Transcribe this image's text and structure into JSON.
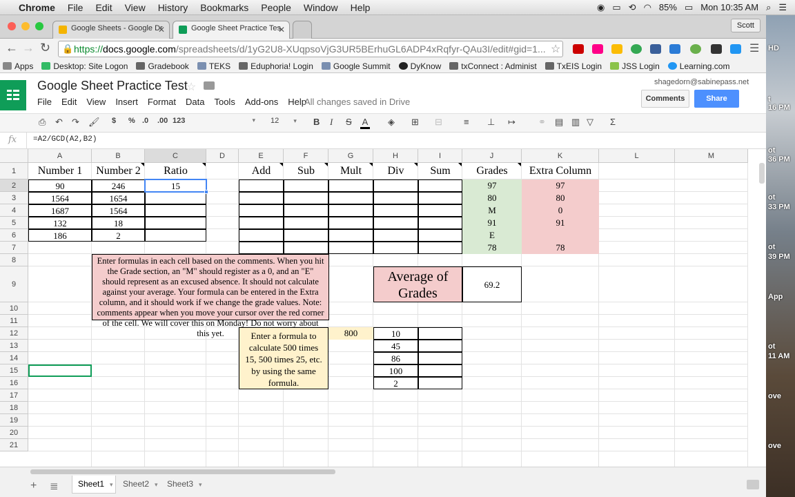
{
  "menubar": {
    "app": "Chrome",
    "items": [
      "File",
      "Edit",
      "View",
      "History",
      "Bookmarks",
      "People",
      "Window",
      "Help"
    ],
    "battery": "85%",
    "clock": "Mon 10:35 AM"
  },
  "browser": {
    "tabs": [
      {
        "title": "Google Sheets - Google Dr"
      },
      {
        "title": "Google Sheet Practice Tes"
      }
    ],
    "profile": "Scott",
    "url_scheme": "https://",
    "url_domain": "docs.google.com",
    "url_rest": "/spreadsheets/d/1yG2U8-XUqpsoVjG3UR5BErhuGL6ADP4xRqfyr-QAu3I/edit#gid=1...",
    "bookmarks": [
      "Apps",
      "Desktop: Site Logon",
      "Gradebook",
      "TEKS",
      "Eduphoria! Login",
      "Google Summit",
      "DyKnow",
      "txConnect : Administ",
      "TxEIS Login",
      "JSS Login",
      "Learning.com"
    ]
  },
  "doc": {
    "title": "Google Sheet Practice Test",
    "menus": [
      "File",
      "Edit",
      "View",
      "Insert",
      "Format",
      "Data",
      "Tools",
      "Add-ons",
      "Help"
    ],
    "saved_status": "All changes saved in Drive",
    "account": "shagedorn@sabinepass.net",
    "comments_label": "Comments",
    "share_label": "Share"
  },
  "format_toolbar": {
    "currency": "$",
    "percent": "%",
    "dec_less": ".0",
    "dec_more": ".00",
    "number_format": "123",
    "font_size": "12",
    "bold": "B",
    "italic": "I",
    "strike": "S",
    "text_color": "A",
    "functions": "Σ"
  },
  "formula_bar": {
    "fx": "fx",
    "formula": "=A2/GCD(A2,B2)"
  },
  "columns": [
    "A",
    "B",
    "C",
    "D",
    "E",
    "F",
    "G",
    "H",
    "I",
    "J",
    "K",
    "L",
    "M"
  ],
  "rows": [
    "1",
    "2",
    "3",
    "4",
    "5",
    "6",
    "7",
    "8",
    "9",
    "10",
    "11",
    "12",
    "13",
    "14",
    "15",
    "16",
    "17",
    "18",
    "19",
    "20",
    "21"
  ],
  "cells": {
    "A1": "Number 1",
    "B1": "Number 2",
    "C1": "Ratio",
    "E1": "Add",
    "F1": "Sub",
    "G1": "Mult",
    "H1": "Div",
    "I1": "Sum",
    "J1": "Grades",
    "K1": "Extra Column",
    "A2": "90",
    "B2": "246",
    "C2": "15",
    "A3": "1564",
    "B3": "1654",
    "A4": "1687",
    "B4": "1564",
    "A5": "132",
    "B5": "18",
    "A6": "186",
    "B6": "2",
    "J2": "97",
    "J3": "80",
    "J4": "M",
    "J5": "91",
    "J6": "E",
    "J7": "78",
    "K2": "97",
    "K3": "80",
    "K4": "0",
    "K5": "91",
    "K6": "",
    "K7": "78",
    "H9": "Average of Grades",
    "J9": "69.2",
    "G12": "800",
    "H12": "10",
    "H13": "45",
    "H14": "86",
    "H15": "100",
    "H16": "2"
  },
  "notes": {
    "instructions": "Enter formulas in each cell based on the comments.  When you hit the Grade section, an \"M\" should register as a 0, and an \"E\" should represent as an excused absence.  It should not calculate against your average.  Your formula can be entered in the Extra column, and it should work if we change the grade values. Note: comments appear when you move your cursor over the red corner of the cell.  We will cover this on Monday!  Do not worry about this yet.",
    "multiply": "Enter a formula to calculate 500 times 15, 500 times 25, etc. by using the same formula."
  },
  "sheets": [
    "Sheet1",
    "Sheet2",
    "Sheet3"
  ],
  "desktop_snippets": [
    "HD",
    "t",
    "16 PM",
    "ot",
    "36 PM",
    "ot",
    "33 PM",
    "ot",
    "39 PM",
    "App",
    "ot",
    "11 AM",
    "ove",
    "ove"
  ]
}
